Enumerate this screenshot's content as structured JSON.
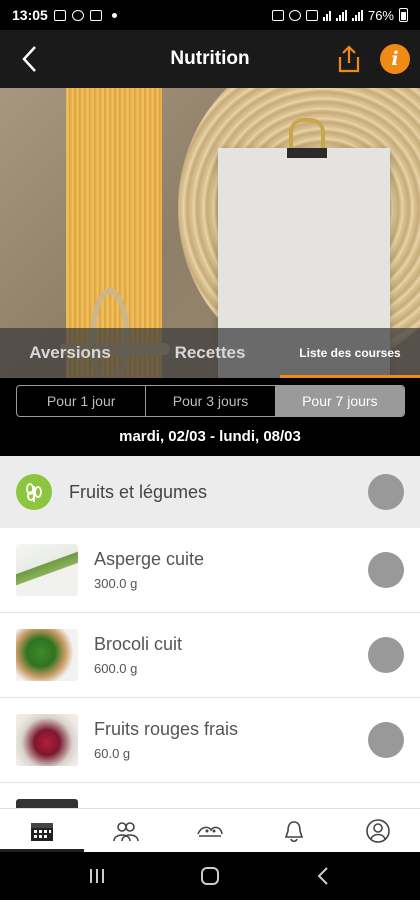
{
  "status_bar": {
    "time": "13:05",
    "battery": "76%"
  },
  "header": {
    "title": "Nutrition",
    "icons": [
      "back-arrow-icon",
      "share-icon",
      "info-icon"
    ],
    "accent_color": "#f08a16"
  },
  "tabs": [
    {
      "label": "Aversions",
      "active": false
    },
    {
      "label": "Recettes",
      "active": false
    },
    {
      "label": "Liste des courses",
      "active": true
    }
  ],
  "period": {
    "options": [
      "Pour 1 jour",
      "Pour 3 jours",
      "Pour 7 jours"
    ],
    "selected": "Pour 7 jours",
    "date_range": "mardi, 02/03 - lundi, 08/03"
  },
  "category": {
    "label": "Fruits et légumes",
    "icon": "vegetable-icon",
    "icon_color": "#8cc63f"
  },
  "items": [
    {
      "name": "Asperge cuite",
      "quantity": "300.0 g"
    },
    {
      "name": "Brocoli cuit",
      "quantity": "600.0 g"
    },
    {
      "name": "Fruits rouges frais",
      "quantity": "60.0 g"
    }
  ],
  "bottom_nav": {
    "items": [
      "calendar-icon",
      "community-icon",
      "coaching-icon",
      "notifications-icon",
      "profile-icon"
    ],
    "active": "calendar-icon"
  }
}
